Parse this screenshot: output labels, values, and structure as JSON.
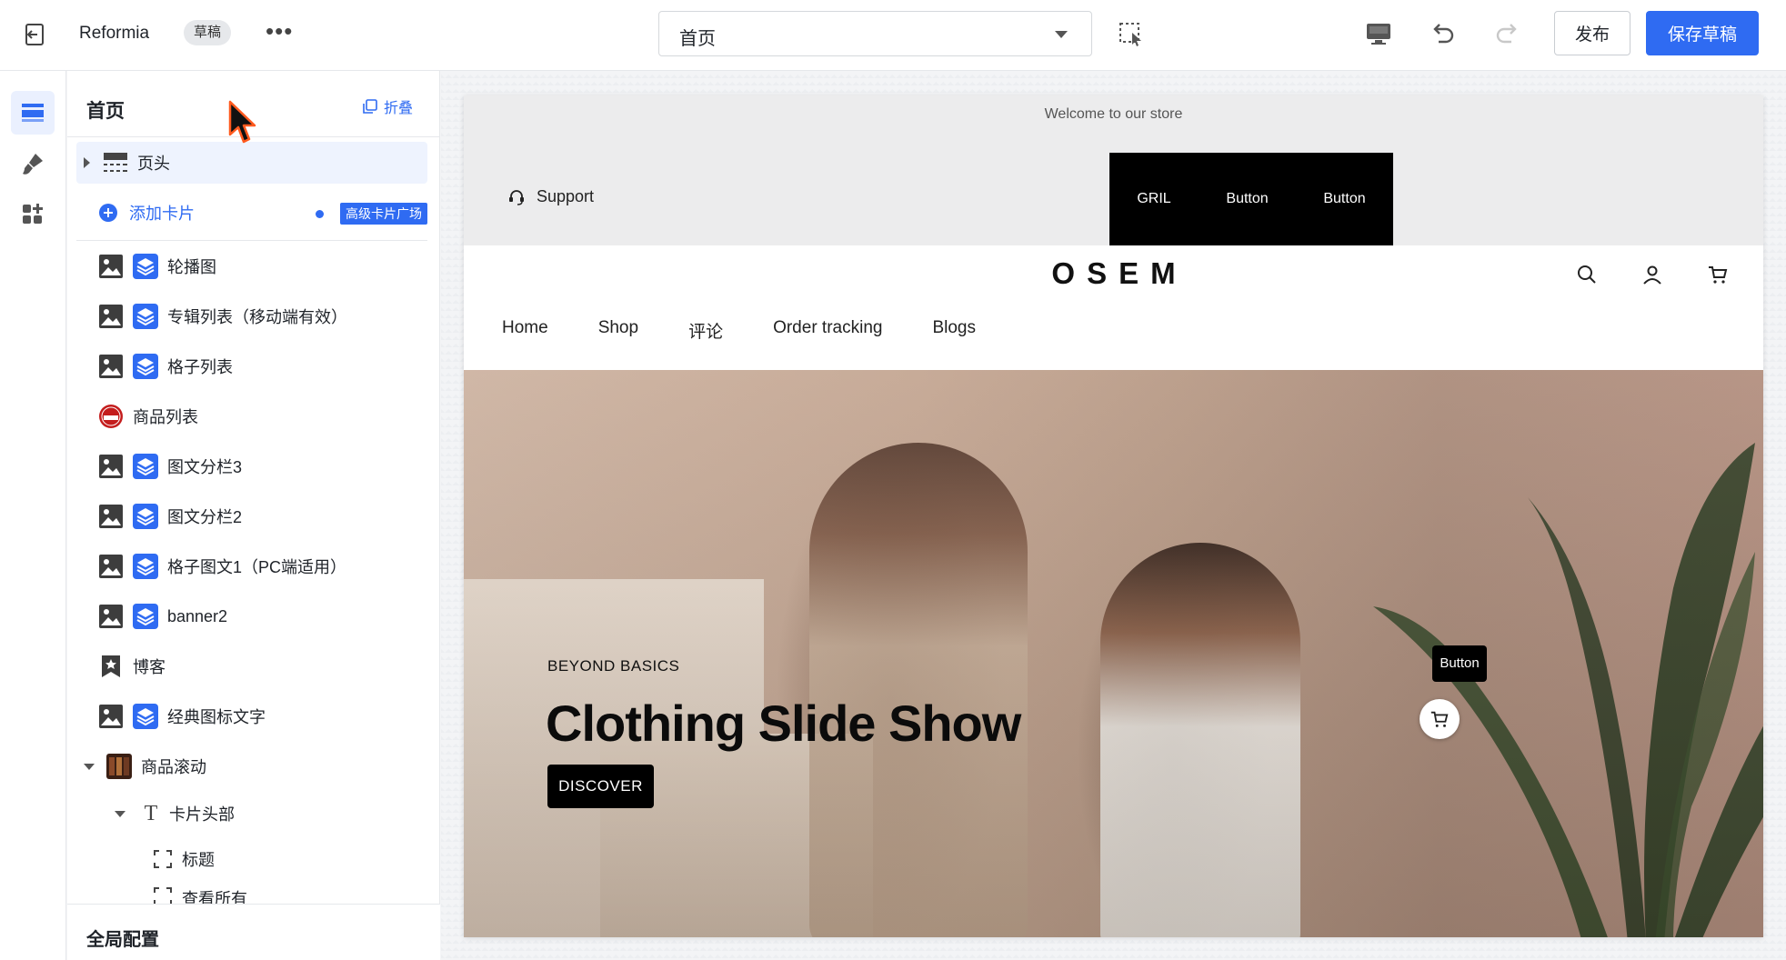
{
  "topbar": {
    "app_name": "Reformia",
    "draft_badge": "草稿",
    "more": "•••",
    "page_select": "首页",
    "publish_label": "发布",
    "save_draft_label": "保存草稿"
  },
  "panel": {
    "title": "首页",
    "collapse_label": "折叠",
    "header_item": "页头",
    "add_card": "添加卡片",
    "card_market": "高级卡片广场",
    "items": [
      "轮播图",
      "专辑列表（移动端有效）",
      "格子列表",
      "商品列表",
      "图文分栏3",
      "图文分栏2",
      "格子图文1（PC端适用）",
      "banner2",
      "博客",
      "经典图标文字",
      "商品滚动",
      "卡片头部",
      "标题",
      "查看所有"
    ],
    "global_config": "全局配置"
  },
  "preview": {
    "announcement": "Welcome to our store",
    "support": "Support",
    "top_buttons": [
      "GRIL",
      "Button",
      "Button"
    ],
    "logo": "OSEM",
    "nav": [
      "Home",
      "Shop",
      "评论",
      "Order tracking",
      "Blogs"
    ],
    "hero_eyebrow": "BEYOND BASICS",
    "hero_title": "Clothing Slide Show",
    "hero_cta": "DISCOVER",
    "floating_button": "Button"
  },
  "colors": {
    "accent": "#2f6bf2",
    "announcement_bg": "#ececed",
    "black_block": "#000000"
  }
}
